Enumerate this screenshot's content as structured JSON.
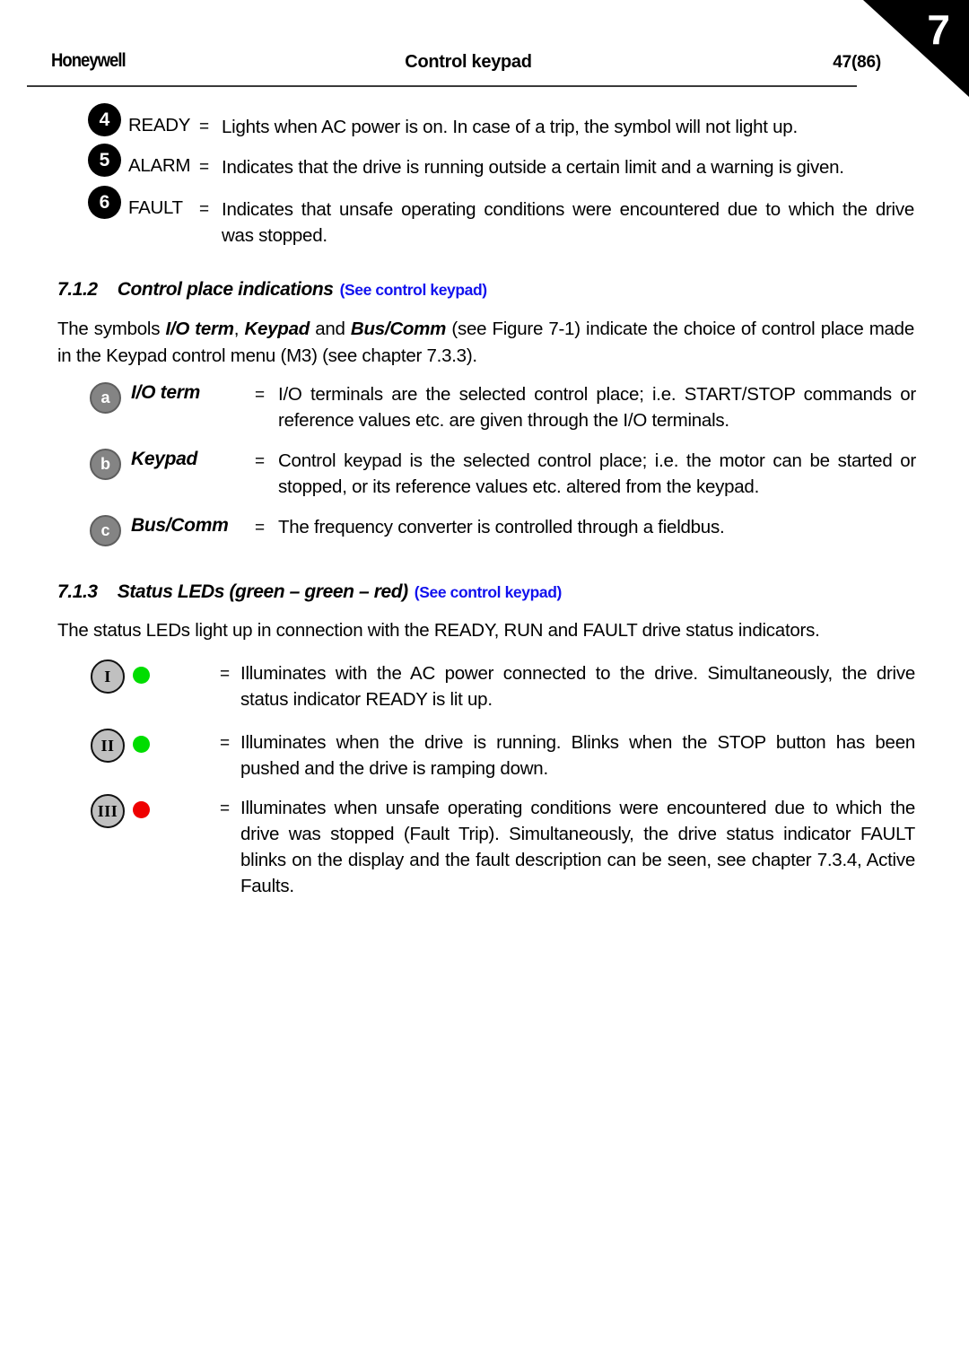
{
  "header": {
    "brand": "Honeywell",
    "title": "Control keypad",
    "page_number": "47(86)",
    "chapter_tab": "7"
  },
  "status_indicators": [
    {
      "badge": "4",
      "label": "READY",
      "equals": "=",
      "description": "Lights when AC power is on. In case of a trip, the symbol will not light up."
    },
    {
      "badge": "5",
      "label": "ALARM",
      "equals": "=",
      "description": "Indicates that the drive is running outside a certain limit and a warning is given."
    },
    {
      "badge": "6",
      "label": "FAULT",
      "equals": "=",
      "description": "Indicates that unsafe operating conditions were encountered due to which the drive was stopped."
    }
  ],
  "section_712": {
    "number": "7.1.2",
    "title": "Control place indications",
    "link": "(See control keypad)",
    "intro_part1": "The symbols ",
    "intro_em1": "I/O term",
    "intro_part2": ", ",
    "intro_em2": "Keypad",
    "intro_part3": " and ",
    "intro_em3": "Bus/Comm",
    "intro_part4": " (see Figure 7-1) indicate the choice of control place made in the Keypad control menu (M3) (see chapter 7.3.3).",
    "items": [
      {
        "badge": "a",
        "label": "I/O term",
        "equals": "=",
        "description": "I/O terminals are the selected control place; i.e. START/STOP commands or reference values etc. are given through the I/O terminals."
      },
      {
        "badge": "b",
        "label": "Keypad",
        "equals": "=",
        "description": "Control keypad is the selected control place; i.e. the motor can be started or stopped, or its reference values etc. altered from the keypad."
      },
      {
        "badge": "c",
        "label": "Bus/Comm",
        "equals": "=",
        "description": "The frequency converter is controlled through a fieldbus."
      }
    ]
  },
  "section_713": {
    "number": "7.1.3",
    "title": "Status LEDs (green – green – red)",
    "link": "(See control keypad)",
    "intro": "The status LEDs light up in connection with the READY, RUN and FAULT drive status indicators.",
    "items": [
      {
        "badge": "I",
        "led_color": "#00dd00",
        "led_name": "green-led-dot",
        "equals": "=",
        "description": "Illuminates with the AC power connected to the drive. Simultaneously, the drive status indicator READY is lit up."
      },
      {
        "badge": "II",
        "led_color": "#00dd00",
        "led_name": "green-led-dot",
        "equals": "=",
        "description": "Illuminates when the drive is running. Blinks when the STOP button has been pushed and the drive is ramping down."
      },
      {
        "badge": "III",
        "led_color": "#ee0000",
        "led_name": "red-led-dot",
        "equals": "=",
        "description": "Illuminates when unsafe operating conditions were encountered due to which the drive was stopped (Fault Trip). Simultaneously, the drive status indicator FAULT blinks on the display and the fault description can be seen, see chapter 7.3.4, Active Faults."
      }
    ]
  },
  "colors": {
    "link_blue": "#1111ee",
    "led_green": "#00dd00",
    "led_red": "#ee0000",
    "badge_gray": "#848484",
    "roman_badge_gray": "#c0c0c0"
  }
}
